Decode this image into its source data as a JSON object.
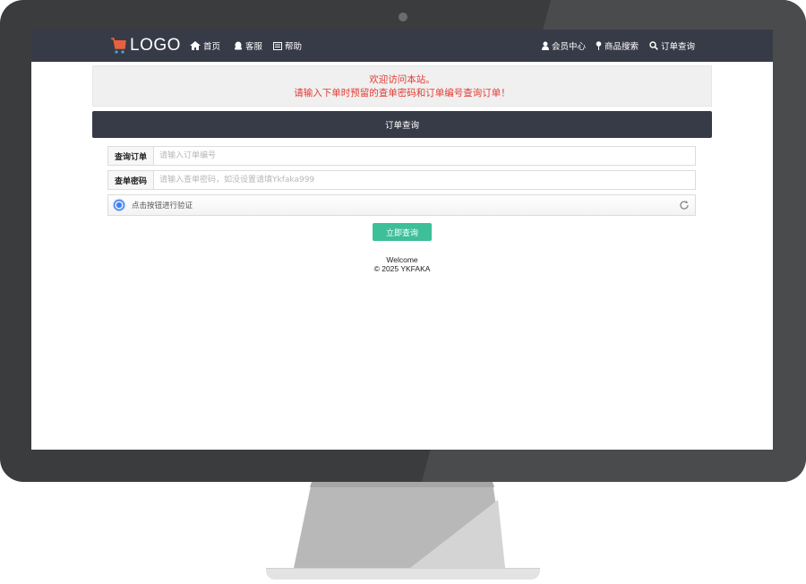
{
  "navbar": {
    "logo_text": "LOGO",
    "left_links": [
      {
        "label": "首页",
        "icon": "home-icon"
      },
      {
        "label": "客服",
        "icon": "qq-icon"
      },
      {
        "label": "帮助",
        "icon": "list-icon"
      }
    ],
    "right_links": [
      {
        "label": "会员中心",
        "icon": "user-icon"
      },
      {
        "label": "商品搜索",
        "icon": "pin-icon"
      },
      {
        "label": "订单查询",
        "icon": "search-icon"
      }
    ]
  },
  "alert": {
    "line1": "欢迎访问本站。",
    "line2": "请输入下单时预留的查单密码和订单编号查询订单！"
  },
  "panel": {
    "title": "订单查询"
  },
  "form": {
    "order": {
      "label": "查询订单",
      "placeholder": "请输入订单编号",
      "value": ""
    },
    "password": {
      "label": "查单密码",
      "placeholder": "请输入查单密码，如没设置请填Ykfaka999",
      "value": ""
    },
    "captcha_text": "点击按钮进行验证",
    "submit_label": "立即查询"
  },
  "footer": {
    "line1": "Welcome",
    "line2": "© 2025 YKFAKA"
  },
  "colors": {
    "navbar_bg": "#373b47",
    "alert_text": "#e33a32",
    "button_bg": "#3dbf99",
    "logo_cart": "#e8613c"
  }
}
